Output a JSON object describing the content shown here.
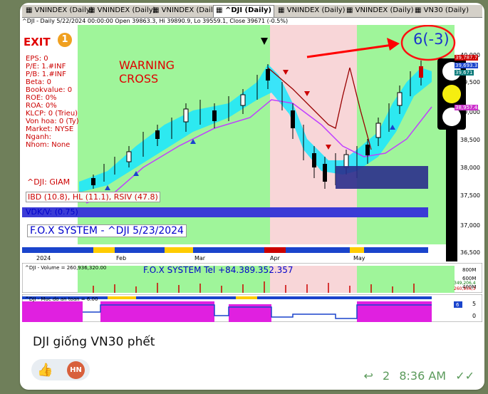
{
  "tabs": [
    {
      "label": "VNINDEX (Daily)",
      "active": false
    },
    {
      "label": "VNINDEX (Daily)",
      "active": false
    },
    {
      "label": "VNINDEX (Daily)",
      "active": false
    },
    {
      "label": "^DJI (Daily)",
      "active": true
    },
    {
      "label": "VNINDEX (Daily)",
      "active": false
    },
    {
      "label": "VNINDEX (Daily)",
      "active": false
    },
    {
      "label": "VN30 (Daily)",
      "active": false
    }
  ],
  "infobar": "^DJI - Daily 5/22/2024 00:00:00 Open 39863.3, Hi 39890.9, Lo 39559.1, Close 39671 (-0.5%)",
  "chart": {
    "exit_label": "EXIT",
    "exit_number": "1",
    "warning_line1": "WARNING",
    "warning_line2": "CROSS",
    "fundamentals": [
      "EPS: 0",
      "P/E: 1.#INF",
      "P/B: 1.#INF",
      "Beta: 0",
      "Bookvalue: 0",
      "ROE: 0%",
      "ROA: 0%",
      "KLCP: 0 (Trieu)",
      "Von hoa: 0 (Ty)",
      "Market: NYSE",
      "Nganh:",
      "Nhom: None"
    ],
    "dji_status": "^DJI: GIAM",
    "ibd_line": "IBD (10.8), HL (11.1), RSIV (47.8)",
    "vdk_line": "VDK/V:  (0.75)",
    "fox_title": "F.O.X SYSTEM - ^DJI 5/23/2024",
    "score": "6(-3)",
    "x_labels": [
      "2024",
      "Feb",
      "Mar",
      "Apr",
      "May"
    ],
    "y_labels": [
      "40,000",
      "39,500",
      "39,000",
      "38,500",
      "38,000",
      "37,500",
      "37,000",
      "36,500"
    ],
    "price_tags": [
      {
        "value": "39,787.7",
        "color": "#cc0000"
      },
      {
        "value": "39,693.3",
        "color": "#1a44cc"
      },
      {
        "value": "39,671",
        "color": "#0a7a7a"
      },
      {
        "value": "38,957.4",
        "color": "#cc33cc"
      }
    ],
    "colors": {
      "green_zone": "#9ff59a",
      "pink_zone": "#f8d6d8",
      "cyan_band": "#19e6ff",
      "magenta_line": "#c040ff",
      "red_line": "#990000",
      "navy_box": "#2a2e8c"
    }
  },
  "volume_panel": {
    "label": "^DJI - Volume = 260,936,320.00",
    "fox_tel": "F.O.X SYSTEM Tel +84.389.352.357",
    "y_labels": [
      "800M",
      "600M",
      "400M"
    ],
    "tags": [
      "349,206,4",
      "260,936,3"
    ]
  },
  "safety_panel": {
    "label": "^DJI - Muc do an toan = 6.00",
    "y_labels": [
      "5",
      "0"
    ],
    "tag": "6"
  },
  "message": {
    "caption": "DJI giống VN30 phết",
    "reaction_emoji": "👍",
    "avatar_initials": "HN",
    "reply_count": "2",
    "time": "8:36 AM"
  }
}
